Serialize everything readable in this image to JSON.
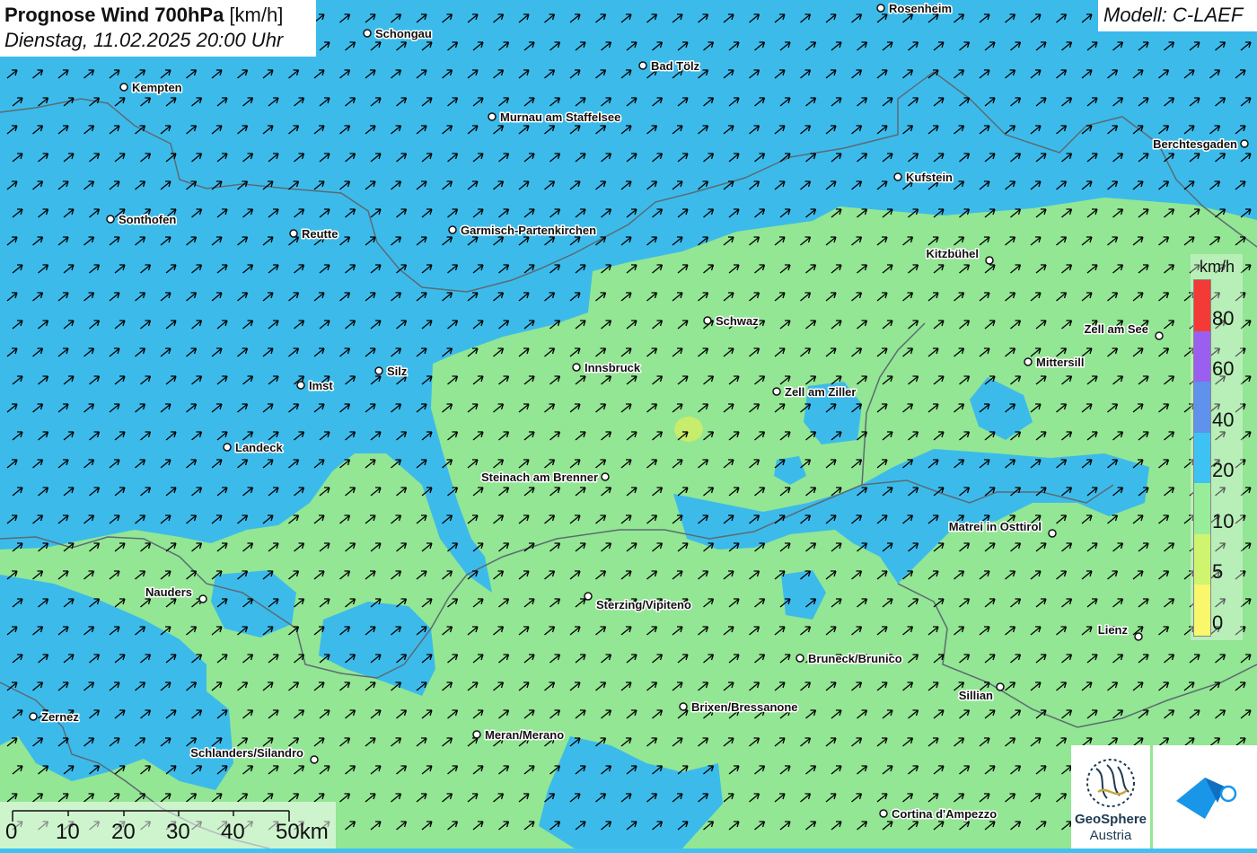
{
  "header": {
    "title_bold": "Prognose Wind 700hPa",
    "title_unit": " [km/h]",
    "datetime": "Dienstag, 11.02.2025 20:00 Uhr",
    "model": "Modell: C-LAEF"
  },
  "legend": {
    "unit": "km/h",
    "classes": [
      {
        "label": "80",
        "color": "#f43a36"
      },
      {
        "label": "60",
        "color": "#9b5ff0"
      },
      {
        "label": "40",
        "color": "#5e92ec"
      },
      {
        "label": "20",
        "color": "#3ec2f3"
      },
      {
        "label": "10",
        "color": "#98ee98"
      },
      {
        "label": "5",
        "color": "#cff46f"
      },
      {
        "label": "0",
        "color": "#f9f76c"
      }
    ]
  },
  "scalebar": {
    "labels": [
      "0",
      "10",
      "20",
      "30",
      "40",
      "50km"
    ]
  },
  "cities": [
    {
      "name": "Rosenheim"
    },
    {
      "name": "Schongau"
    },
    {
      "name": "Bad Tölz"
    },
    {
      "name": "Kempten"
    },
    {
      "name": "Murnau am Staffelsee"
    },
    {
      "name": "Berchtesgaden"
    },
    {
      "name": "Kufstein"
    },
    {
      "name": "Sonthofen"
    },
    {
      "name": "Reutte"
    },
    {
      "name": "Garmisch-Partenkirchen"
    },
    {
      "name": "Kitzbühel"
    },
    {
      "name": "Schwaz"
    },
    {
      "name": "Zell am See"
    },
    {
      "name": "Innsbruck"
    },
    {
      "name": "Silz"
    },
    {
      "name": "Mittersill"
    },
    {
      "name": "Imst"
    },
    {
      "name": "Zell am Ziller"
    },
    {
      "name": "Landeck"
    },
    {
      "name": "Steinach am Brenner"
    },
    {
      "name": "Matrei in Osttirol"
    },
    {
      "name": "Nauders"
    },
    {
      "name": "Sterzing/Vipiteno"
    },
    {
      "name": "Lienz"
    },
    {
      "name": "Bruneck/Brunico"
    },
    {
      "name": "Sillian"
    },
    {
      "name": "Zernez"
    },
    {
      "name": "Brixen/Bressanone"
    },
    {
      "name": "Meran/Merano"
    },
    {
      "name": "Schlanders/Silandro"
    },
    {
      "name": "Cortina d'Ampezzo"
    }
  ],
  "wind": {
    "direction": "southwest",
    "arrow_color": "#000000"
  },
  "logos": {
    "geosphere_line1": "GeoSphere",
    "geosphere_line2": "Austria"
  }
}
